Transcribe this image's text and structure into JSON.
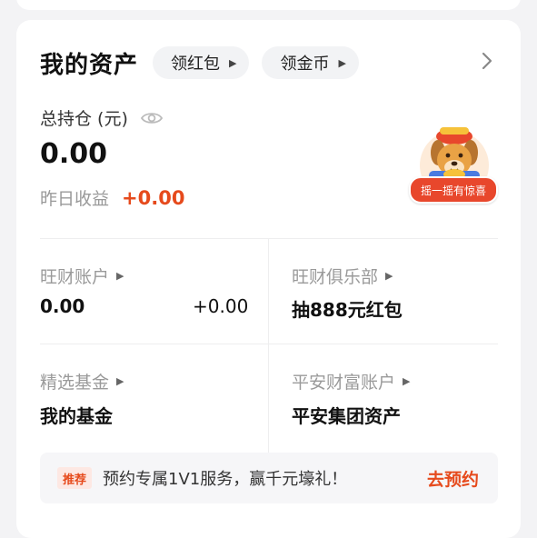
{
  "header": {
    "title": "我的资产",
    "pill_red_packet": "领红包",
    "pill_gold_coin": "领金币"
  },
  "summary": {
    "holding_label": "总持仓 (元)",
    "holding_value": "0.00",
    "yesterday_label": "昨日收益",
    "yesterday_value": "+0.00"
  },
  "mascot": {
    "badge": "摇一摇有惊喜"
  },
  "grid": {
    "wangcai_account": {
      "label": "旺财账户",
      "value": "0.00",
      "change": "+0.00"
    },
    "wangcai_club": {
      "label": "旺财俱乐部",
      "value": "抽888元红包"
    },
    "selected_funds": {
      "label": "精选基金",
      "value": "我的基金"
    },
    "pingan_wealth": {
      "label": "平安财富账户",
      "value": "平安集团资产"
    }
  },
  "promo": {
    "badge": "推荐",
    "text": "预约专属1V1服务，赢千元壕礼！",
    "cta": "去预约"
  },
  "colors": {
    "accent": "#e64a1c",
    "badge_bg": "#fde8e3",
    "page_bg": "#f3f3f5"
  }
}
